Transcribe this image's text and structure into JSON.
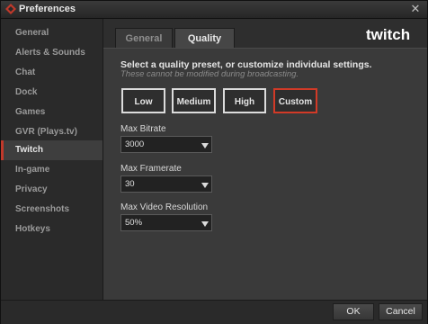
{
  "window": {
    "title": "Preferences",
    "app_icon": "preferences-app-icon",
    "close_icon": "close-icon",
    "close_glyph": "✕"
  },
  "sidebar": {
    "items": [
      {
        "label": "General"
      },
      {
        "label": "Alerts & Sounds"
      },
      {
        "label": "Chat"
      },
      {
        "label": "Dock"
      },
      {
        "label": "Games"
      },
      {
        "label": "GVR (Plays.tv)"
      },
      {
        "label": "Twitch",
        "active": true
      },
      {
        "label": "In-game"
      },
      {
        "label": "Privacy"
      },
      {
        "label": "Screenshots"
      },
      {
        "label": "Hotkeys"
      }
    ],
    "active_color": "#c0392b"
  },
  "tabs": {
    "general": "General",
    "quality": "Quality",
    "active": "Quality"
  },
  "logo": {
    "text": "twitch",
    "color": "#ffffff"
  },
  "quality": {
    "heading": "Select a quality preset, or customize individual settings.",
    "subheading": "These cannot be modified during broadcasting.",
    "presets": {
      "low": "Low",
      "medium": "Medium",
      "high": "High",
      "custom": "Custom",
      "selected": "Custom"
    },
    "selected_color": "#d23a27",
    "max_bitrate": {
      "label": "Max Bitrate",
      "value": "3000"
    },
    "max_framerate": {
      "label": "Max Framerate",
      "value": "30"
    },
    "max_resolution": {
      "label": "Max Video Resolution",
      "value": "50%"
    }
  },
  "footer": {
    "ok": "OK",
    "cancel": "Cancel"
  }
}
